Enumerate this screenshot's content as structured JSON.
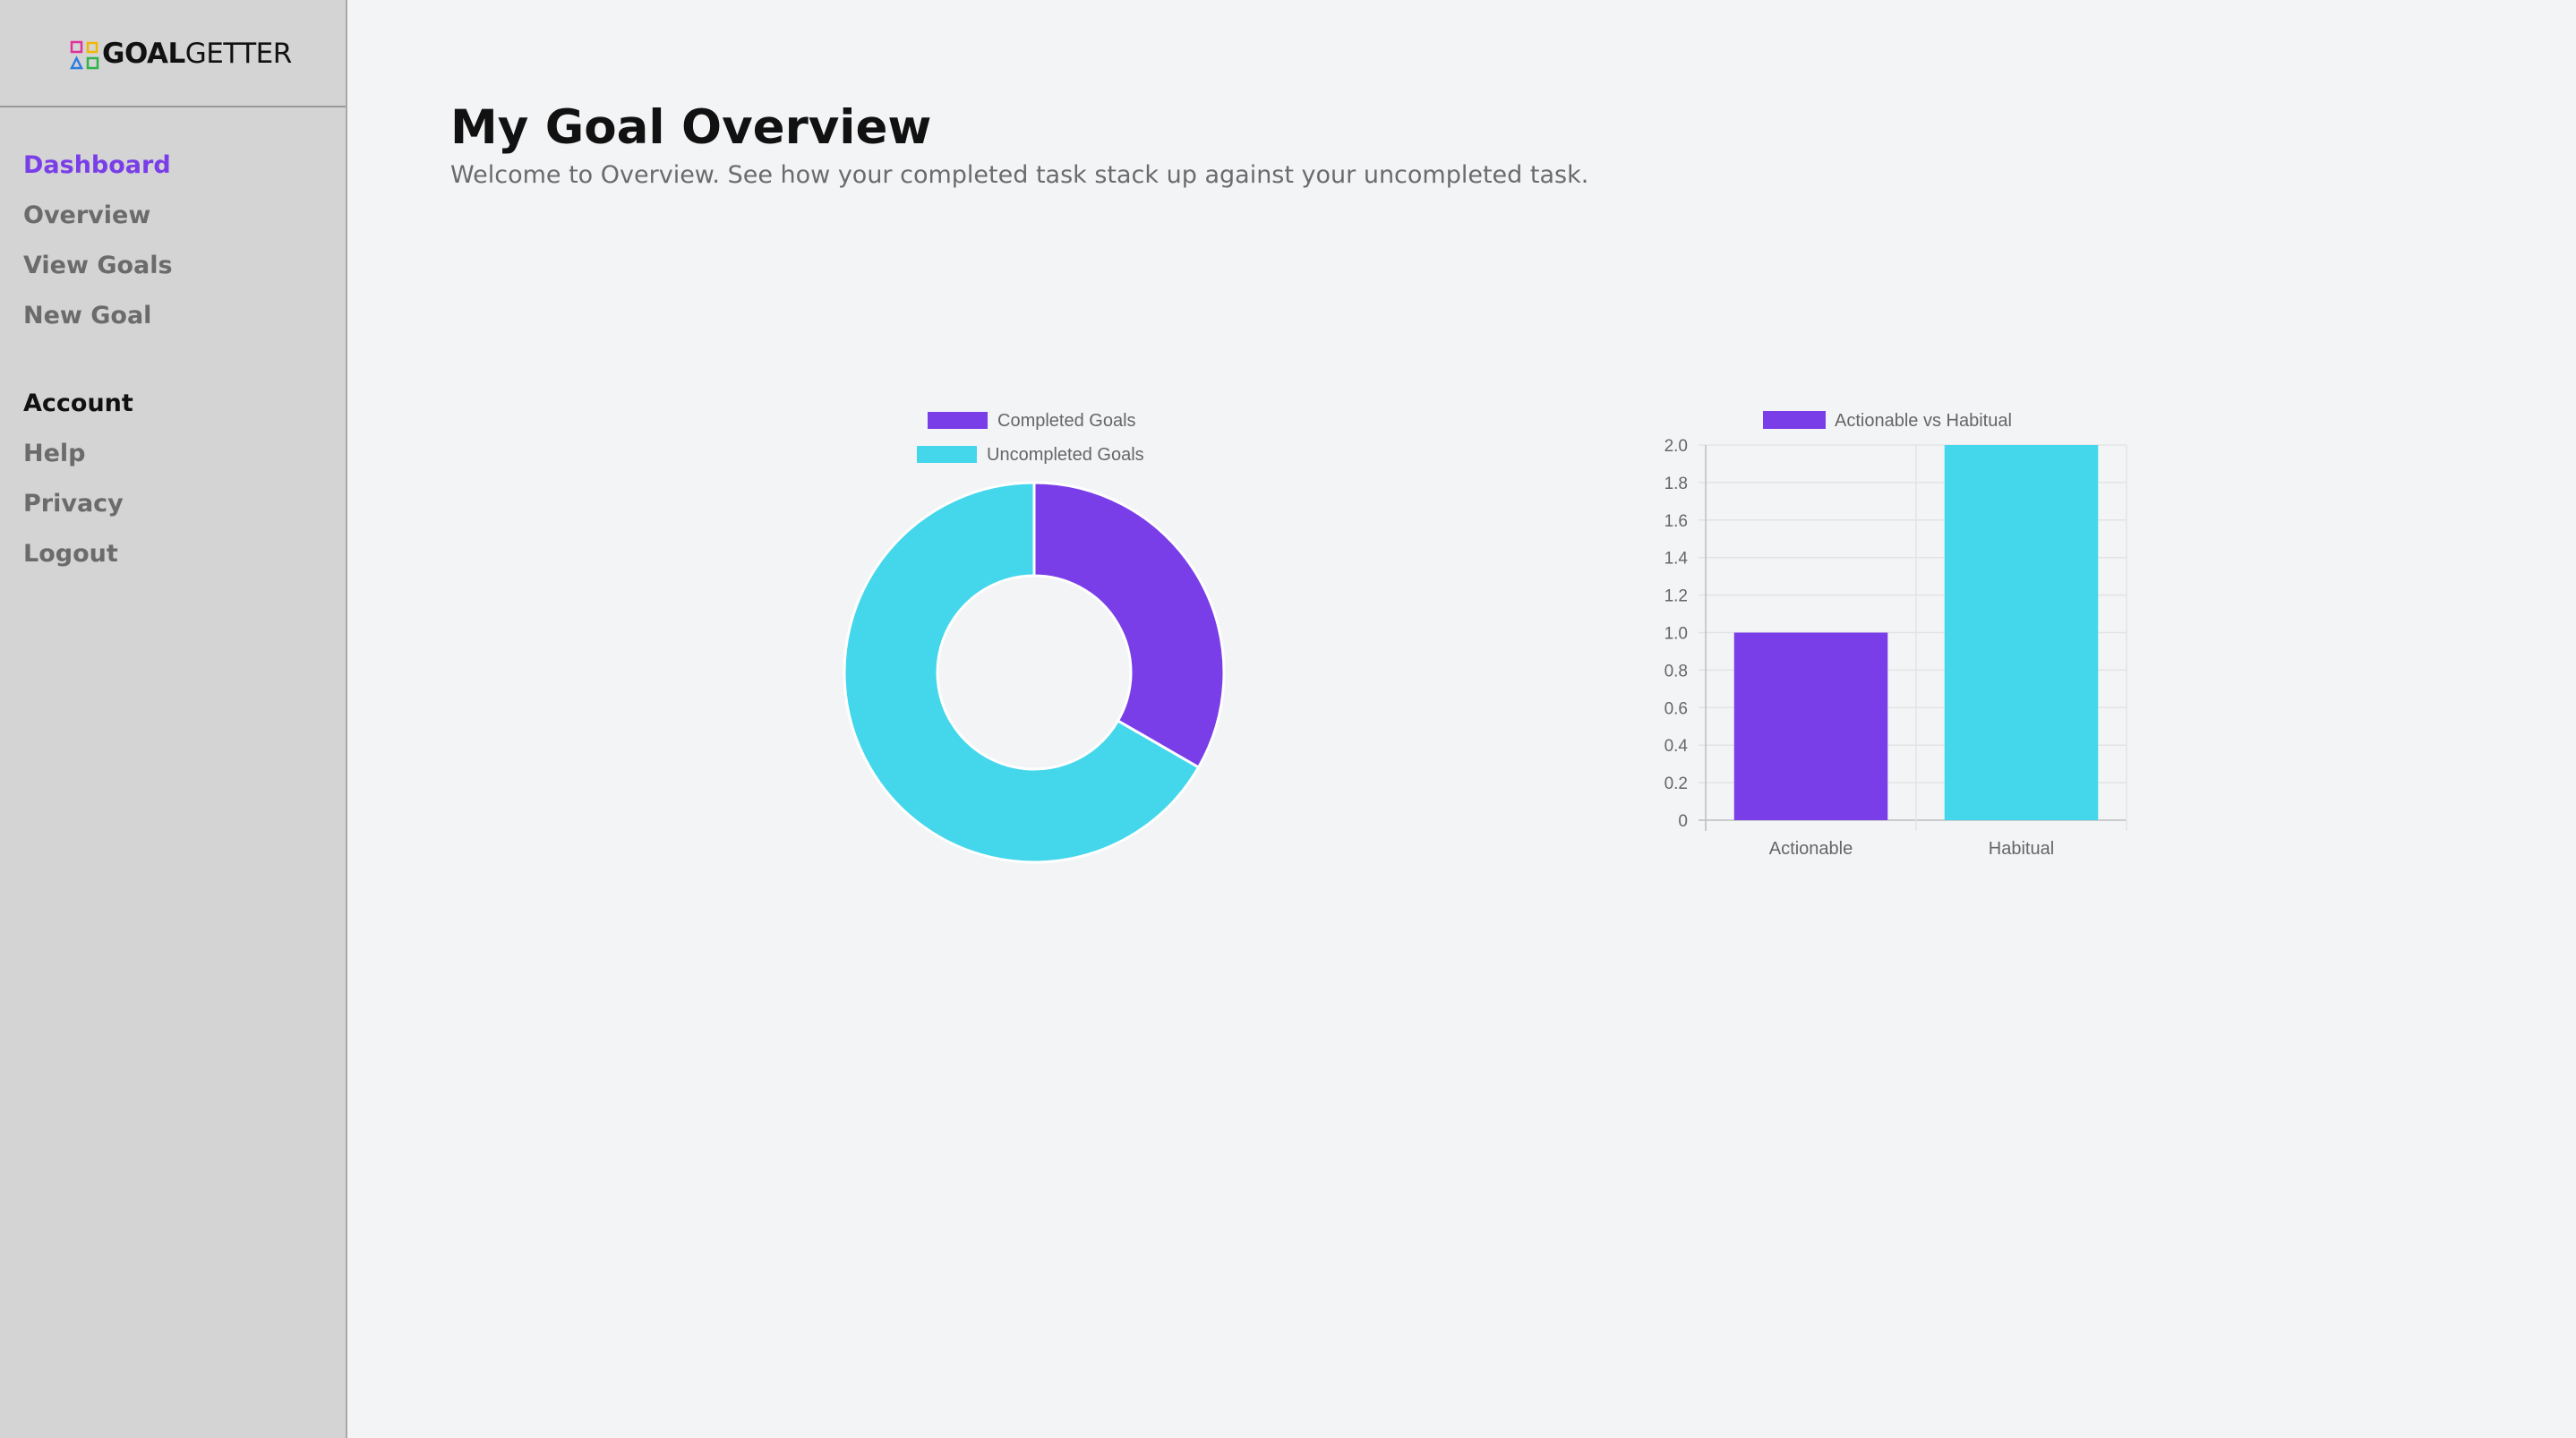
{
  "app": {
    "logo_bold": "GOAL",
    "logo_light": "GETTER",
    "logo_icon": "shapes-logo-icon"
  },
  "sidebar": {
    "main_items": [
      {
        "label": "Dashboard",
        "active": true
      },
      {
        "label": "Overview",
        "active": false
      },
      {
        "label": "View Goals",
        "active": false
      },
      {
        "label": "New Goal",
        "active": false
      }
    ],
    "account_heading": "Account",
    "account_items": [
      {
        "label": "Help"
      },
      {
        "label": "Privacy"
      },
      {
        "label": "Logout"
      }
    ]
  },
  "page": {
    "title": "My Goal Overview",
    "subtitle": "Welcome to Overview. See how your completed task stack up against your uncompleted task."
  },
  "colors": {
    "accent": "#7a3ee8",
    "secondary": "#44d7ec"
  },
  "chart_data": [
    {
      "type": "pie",
      "variant": "doughnut",
      "labels": [
        "Completed Goals",
        "Uncompleted Goals"
      ],
      "values": [
        1,
        2
      ],
      "colors": [
        "#7a3ee8",
        "#44d7ec"
      ],
      "legend": "top"
    },
    {
      "type": "bar",
      "categories": [
        "Actionable",
        "Habitual"
      ],
      "series": [
        {
          "name": "Actionable vs Habitual",
          "values": [
            1,
            2
          ]
        }
      ],
      "bar_colors": [
        "#7a3ee8",
        "#44d7ec"
      ],
      "ylim": [
        0,
        2
      ],
      "yticks": [
        "0",
        "0.2",
        "0.4",
        "0.6",
        "0.8",
        "1.0",
        "1.2",
        "1.4",
        "1.6",
        "1.8",
        "2.0"
      ],
      "grid": true,
      "legend": "top"
    }
  ]
}
